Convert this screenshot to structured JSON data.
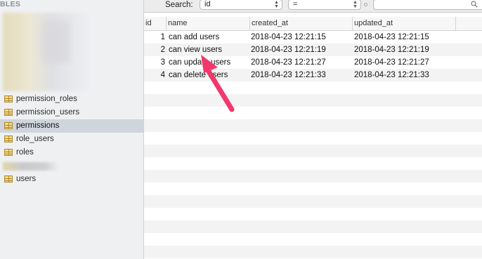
{
  "sidebar": {
    "heading": "BLES",
    "tables": [
      {
        "label": "permission_roles",
        "selected": false
      },
      {
        "label": "permission_users",
        "selected": false
      },
      {
        "label": "permissions",
        "selected": true
      },
      {
        "label": "role_users",
        "selected": false
      },
      {
        "label": "roles",
        "selected": false
      },
      {
        "label": "users",
        "selected": false
      }
    ]
  },
  "search": {
    "label": "Search:",
    "field": "id",
    "operator": "=",
    "value": ""
  },
  "grid": {
    "columns": [
      "id",
      "name",
      "created_at",
      "updated_at"
    ],
    "rows": [
      {
        "id": "1",
        "name": "can add users",
        "created_at": "2018-04-23 12:21:15",
        "updated_at": "2018-04-23 12:21:15"
      },
      {
        "id": "2",
        "name": "can view users",
        "created_at": "2018-04-23 12:21:19",
        "updated_at": "2018-04-23 12:21:19"
      },
      {
        "id": "3",
        "name": "can update users",
        "created_at": "2018-04-23 12:21:27",
        "updated_at": "2018-04-23 12:21:27"
      },
      {
        "id": "4",
        "name": "can delete users",
        "created_at": "2018-04-23 12:21:33",
        "updated_at": "2018-04-23 12:21:33"
      }
    ]
  },
  "colors": {
    "arrow": "#f2386b",
    "selection": "#cfd5dc",
    "sidebar_bg": "#eef0f2"
  }
}
